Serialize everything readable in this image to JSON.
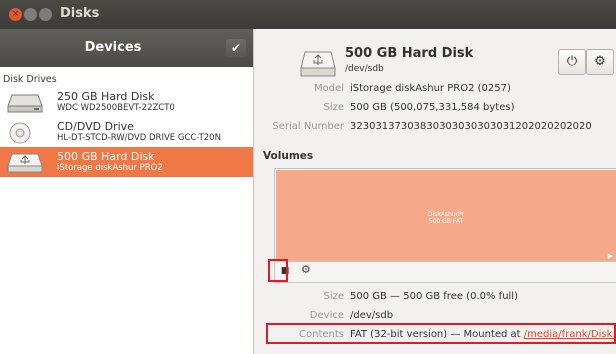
{
  "window": {
    "title": "Disks"
  },
  "sidebar": {
    "header": "Devices",
    "check_icon": "checkmark-icon",
    "group_label": "Disk Drives",
    "devices": [
      {
        "name": "250 GB Hard Disk",
        "sub": "WDC WD2500BEVT-22ZCT0",
        "icon": "hard-disk-icon"
      },
      {
        "name": "CD/DVD Drive",
        "sub": "HL-DT-STCD-RW/DVD DRIVE GCC-T20N",
        "icon": "optical-disc-icon"
      },
      {
        "name": "500 GB Hard Disk",
        "sub": "iStorage diskAshur PRO2",
        "icon": "usb-disk-icon",
        "selected": true
      }
    ]
  },
  "main": {
    "title": "500 GB Hard Disk",
    "subtitle": "/dev/sdb",
    "power_icon": "⏻",
    "gear_icon": "⚙",
    "model_label": "Model",
    "model_value": "iStorage diskAshur PRO2 (0257)",
    "size_label": "Size",
    "size_value": "500 GB (500,075,331,584 bytes)",
    "serial_label": "Serial Number",
    "serial_value": "32303137303830303030303031202020202020",
    "volumes_heading": "Volumes",
    "partition": {
      "name": "DiskAshurPr",
      "size": "500 GB FAT"
    },
    "vol_size_label": "Size",
    "vol_size_value": "500 GB — 500 GB free (0.0% full)",
    "device_label": "Device",
    "device_value": "/dev/sdb",
    "contents_label": "Contents",
    "contents_value": "FAT (32-bit version) — Mounted at ",
    "contents_link": "/media/frank/Disk…"
  },
  "colors": {
    "accent": "#f07746",
    "partition": "#f5a98a",
    "highlight": "#e01b24",
    "titlebar": "#3c3b37"
  }
}
